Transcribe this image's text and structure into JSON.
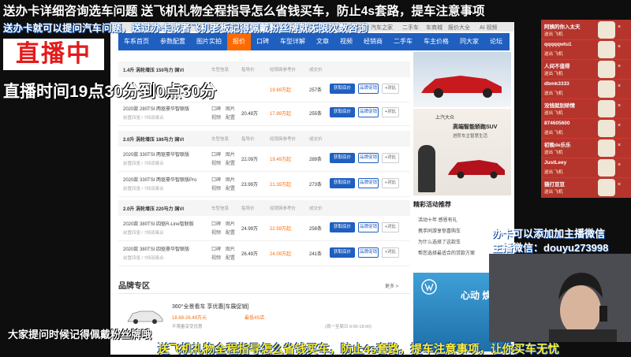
{
  "stream": {
    "marquee_top": "送办卡详细咨询选车问题  送飞机礼物全程指导怎么省钱买车，防止4s套路，提车注意事项",
    "subtitle_line": "送办卡就可以提问汽车问题，送过办卡或者飞机老板记得佩戴粉丝牌就无限次数咨询",
    "live_badge": "直播中",
    "schedule": "直播时间19点30分到0点30分",
    "bottom_left": "大家提问时候记得佩戴粉丝牌哦",
    "marquee_bottom": "送飞机礼物全程指导怎么省钱买车，防止4s套路，提车注意事项，让你买车无忧",
    "wechat_line1": "办卡可以添加加主播微信",
    "wechat_line2": "主播微信：douyu273998"
  },
  "gifts": [
    {
      "name": "阿姨的你入太天",
      "sub": "送出 飞机"
    },
    {
      "name": "qqqqqwtu1",
      "sub": "送出 飞机"
    },
    {
      "name": "人间不值得",
      "sub": "送出 飞机"
    },
    {
      "name": "dbmk3333",
      "sub": "送出 飞机"
    },
    {
      "name": "没钱就别矫情",
      "sub": "送出 飞机"
    },
    {
      "name": "874605600",
      "sub": "送出 飞机"
    },
    {
      "name": "初晚de乐乐",
      "sub": "送出 飞机"
    },
    {
      "name": "JustLeey",
      "sub": "送出 飞机"
    },
    {
      "name": "猫打豆豆",
      "sub": "送出 飞机"
    }
  ],
  "gift_icon_color": "#f0e6d6",
  "site": {
    "topstrip": [
      "汽车之家",
      "二手车",
      "车商城",
      "报价大全",
      "AI 视频"
    ],
    "nav": [
      "车系首页",
      "参数配置",
      "图片实拍",
      "报价",
      "口碑",
      "车型详解",
      "文章",
      "视频",
      "经销商",
      "二手车",
      "车主价格",
      "同大家",
      "论坛"
    ],
    "nav_active": "报价",
    "sections": [
      {
        "title": "1.4升 涡轮增压 150马力 国VI",
        "h1": "车型信息",
        "h2": "指导价",
        "h3": "经销商参考价",
        "h4": "成交价"
      },
      {
        "title": "2.0升 涡轮增压 186马力 国VI",
        "h1": "车型信息",
        "h2": "指导价",
        "h3": "经销商参考价",
        "h4": "成交价"
      },
      {
        "title": "2.0升 涡轮增压 220马力 国VI",
        "h1": "车型信息",
        "h2": "指导价",
        "h3": "经销商参考价",
        "h4": "成交价"
      }
    ],
    "rows": [
      {
        "name": "",
        "sub": "",
        "t1": "",
        "t2": "",
        "t3": "",
        "t4": "",
        "p1": "",
        "p2": "19.69万起",
        "cnt": "257条",
        "q": "获取底价",
        "p": "品牌促销",
        "c": "+对比"
      },
      {
        "name": "2020款 280TSI 两驱豪华智联版",
        "sub": "前置四驱 / 7挡双离合",
        "t1": "口碑",
        "t2": "视频",
        "t3": "图片",
        "t4": "配置",
        "p1": "20.49万",
        "p2": "17.89万起",
        "cnt": "255条",
        "q": "获取底价",
        "p": "品牌促销",
        "c": "+对比"
      },
      {
        "name": "2020款 330TSI 两驱豪华智联版",
        "sub": "前置四驱 / 7挡双离合",
        "t1": "口碑",
        "t2": "视频",
        "t3": "图片",
        "t4": "配置",
        "p1": "22.09万",
        "p2": "19.49万起",
        "cnt": "289条",
        "q": "获取底价",
        "p": "品牌促销",
        "c": "+对比"
      },
      {
        "name": "2020款 330TSI 两驱豪华智联版Pro",
        "sub": "前置四驱 / 7挡双离合",
        "t1": "口碑",
        "t2": "视频",
        "t3": "图片",
        "t4": "配置",
        "p1": "23.99万",
        "p2": "21.39万起",
        "cnt": "273条",
        "q": "获取底价",
        "p": "品牌促销",
        "c": "+对比"
      },
      {
        "name": "2020款 380TSI 四驱R-Line智联版",
        "sub": "前置四驱 / 7挡双离合",
        "t1": "口碑",
        "t2": "视频",
        "t3": "图片",
        "t4": "配置",
        "p1": "24.99万",
        "p2": "22.59万起",
        "cnt": "258条",
        "q": "获取底价",
        "p": "品牌促销",
        "c": "+对比"
      },
      {
        "name": "2020款 380TSI 四驱豪华智联版",
        "sub": "前置四驱 / 7挡双离合",
        "t1": "口碑",
        "t2": "视频",
        "t3": "图片",
        "t4": "配置",
        "p1": "26.49万",
        "p2": "24.09万起",
        "cnt": "241条",
        "q": "获取底价",
        "p": "品牌促销",
        "c": "+对比"
      }
    ],
    "brand_zone": {
      "title": "品牌专区",
      "more": "更多 >",
      "promo": "360°全景看车 享优惠[车展促销]",
      "price": "18.69-26.49万元",
      "tag": "最低4S店",
      "note": "不限量享受优惠",
      "hours": "(周一至周日 9:00-18:00)"
    },
    "right": {
      "ad_title": "高端智能轿跑SUV",
      "ad_sub": "进阶车主智慧生活",
      "brand": "上汽大众",
      "activities_title": "精彩活动推荐",
      "activities": [
        "活动十年 感恩有礼",
        "携手同游享惊喜购车",
        "为什么选择了这款车",
        "帮您选择最适合的贷款方案"
      ],
      "ad2": "心动 焕然"
    }
  }
}
